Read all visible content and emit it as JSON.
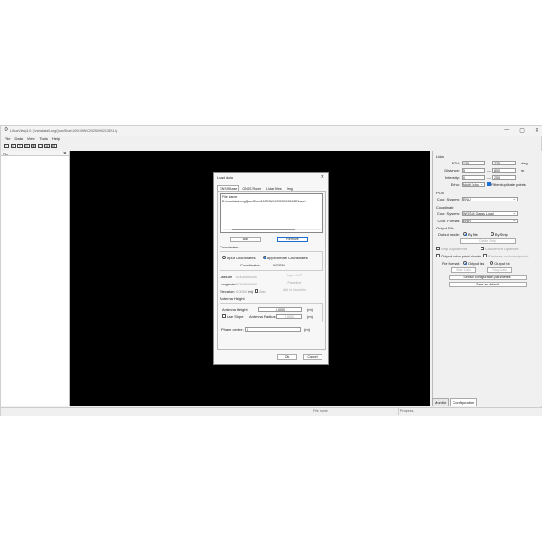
{
  "window": {
    "title": "LiHuaView(4.0.1)\\newdata\\LongQuanShan\\100C\\5W\\C29250\\9021\\3D\\1.lp",
    "minimize": "—",
    "maximize": "▢",
    "close": "✕"
  },
  "menu": [
    "File",
    "Data",
    "View",
    "Tools",
    "Help"
  ],
  "toolbar_icons": [
    "new-icon",
    "open-icon",
    "save-icon",
    "folder-icon",
    "grid-icon",
    "monitor-icon",
    "camera-icon",
    "settings-icon"
  ],
  "left_panel": {
    "title": "File",
    "close": "✕"
  },
  "right_tabs": [
    "Monitor",
    "Configuration"
  ],
  "status": {
    "file_name": "File name",
    "progress": "Progress"
  },
  "config": {
    "lidar": {
      "section": "Lidar",
      "fov_label": "FOV:",
      "fov_min": "135",
      "fov_sep": "—",
      "fov_max": "225",
      "fov_unit": "deg",
      "distance_label": "Distance:",
      "distance_min": "5",
      "distance_sep": "—",
      "distance_max": "800",
      "distance_unit": "m",
      "intensity_label": "Intensity:",
      "intensity_min": "0",
      "intensity_sep": "—",
      "intensity_max": "255",
      "echo_label": "Echo:",
      "echo_value": "Multi Echo",
      "filter_duplicate": "Filter duplicate points"
    },
    "pos": {
      "section": "POS",
      "coor_system_label": "Coor. System:",
      "coor_system_value": "ENU"
    },
    "coordinate": {
      "section": "Coordinate",
      "coor_system_label": "Coor. System:",
      "coor_system_value": "WGS84 Gauss Local",
      "coor_format_label": "Coor. Format:",
      "coor_format_value": "ENH"
    },
    "output": {
      "section": "Output File",
      "mode_label": "Output mode:",
      "by_file": "By file",
      "by_strip": "By Strip",
      "divide_strip": "Divide Strip",
      "strip_adjustment": "Strip Adjustment",
      "cloudpoint_optimize": "CloudPoint Optimize",
      "output_color": "Output color point clouds",
      "eliminate_occluded": "Eliminate occluded points",
      "file_format_label": "File format:",
      "output_las": "Output las",
      "output_txt": "Output txt",
      "start_calc": "Start Calc",
      "stop_calc": "Stop Calc",
      "sensor_params": "Sensor configuration parameters",
      "save_default": "Save as default"
    }
  },
  "dialog": {
    "title": "Load data",
    "close": "✕",
    "tabs": [
      "GNSS Base",
      "GNSS Rover",
      "Lidar Files",
      "Img"
    ],
    "file_header": "File Name",
    "file_path": "D:\\newdata\\LongQuanShan\\100C\\5W\\C29250\\9021\\3D\\base\\",
    "add": "Add",
    "remove": "Remove",
    "coordinates_section": "Coordinates",
    "input_coordinates": "Input Coordinates",
    "approximate_coordinates": "Approximate Coordinates",
    "coordinates_label": "Coordinates:",
    "coordinates_value": "WGS84",
    "latitude_label": "Latitude",
    "latitude_value": "0.000000000",
    "input_xyz": "Input XYZ",
    "longitude_label": "Longitude",
    "longitude_value": "0.000000000",
    "parseline": "Parseline",
    "elevation_label": "Elevation",
    "elevation_value": "0.0000",
    "elevation_unit": "(m)",
    "also": "Also",
    "add_favorites": "Add to Favorites",
    "antenna_section": "Antenna Height",
    "antenna_height_label": "Antenna Height:",
    "antenna_height_value": "0.0000",
    "antenna_height_unit": "(m)",
    "use_slope": "Use Slope",
    "antenna_radius_label": "Antenna Radius:",
    "antenna_radius_value": "0.0000",
    "antenna_radius_unit": "(m)",
    "phase_centre_label": "Phase centre:",
    "phase_centre_value": "0",
    "phase_centre_unit": "(m)",
    "ok": "Ok",
    "cancel": "Cancel"
  }
}
